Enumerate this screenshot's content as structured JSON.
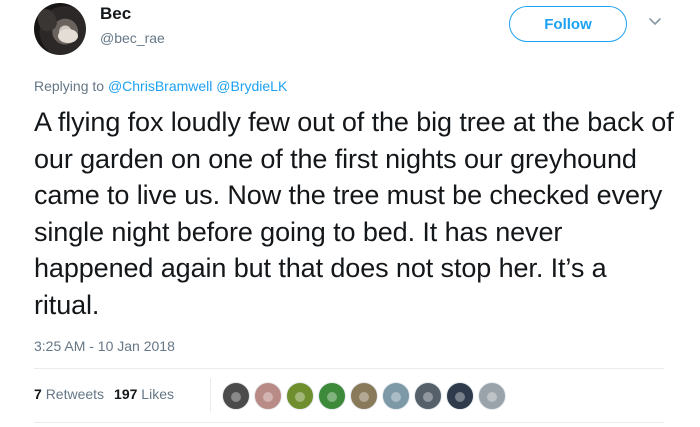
{
  "author": {
    "name": "Bec",
    "handle": "@bec_rae"
  },
  "follow_button_label": "Follow",
  "reply_to": {
    "prefix": "Replying to",
    "mentions": [
      "@ChrisBramwell",
      "@BrydieLK"
    ]
  },
  "tweet_text": "A flying fox loudly few out of the big tree at the back of our garden on one of the first nights our greyhound came to live us. Now the tree must be checked every single night before going to bed. It has never happened again but that does not stop her. It’s a ritual.",
  "timestamp": "3:25 AM - 10 Jan 2018",
  "stats": {
    "retweets_count": "7",
    "retweets_label": "Retweets",
    "likes_count": "197",
    "likes_label": "Likes"
  },
  "likers": [
    {
      "icon": "liker-avatar-1",
      "color": "#4b4b4b"
    },
    {
      "icon": "liker-avatar-2",
      "color": "#b98b86"
    },
    {
      "icon": "liker-avatar-3",
      "color": "#6f8f2f"
    },
    {
      "icon": "liker-avatar-4",
      "color": "#3d8a3a"
    },
    {
      "icon": "liker-avatar-5",
      "color": "#8a7a5c"
    },
    {
      "icon": "liker-avatar-6",
      "color": "#7d98a6"
    },
    {
      "icon": "liker-avatar-7",
      "color": "#55606a"
    },
    {
      "icon": "liker-avatar-8",
      "color": "#2f3b4c"
    },
    {
      "icon": "liker-avatar-9",
      "color": "#9aa3aa"
    }
  ],
  "colors": {
    "accent": "#1da1f2",
    "secondary_text": "#657786",
    "primary_text": "#14171a"
  }
}
